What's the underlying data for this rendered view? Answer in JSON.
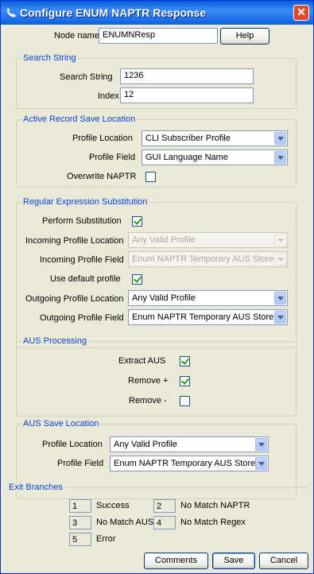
{
  "window": {
    "title": "Configure ENUM NAPTR Response",
    "close_glyph": "✕"
  },
  "node": {
    "label": "Node name",
    "value": "ENUMNResp",
    "help_label": "Help"
  },
  "search_string": {
    "title": "Search String",
    "search_label": "Search String",
    "search_value": "1236",
    "index_label": "Index",
    "index_value": "12"
  },
  "active_record": {
    "title": "Active Record Save Location",
    "profile_location_label": "Profile Location",
    "profile_location_value": "CLI Subscriber Profile",
    "profile_field_label": "Profile Field",
    "profile_field_value": "GUI Language Name",
    "overwrite_label": "Overwrite NAPTR",
    "overwrite_checked": false
  },
  "regex": {
    "title": "Regular Expression Substitution",
    "perform_label": "Perform Substitution",
    "perform_checked": true,
    "incoming_location_label": "Incoming Profile Location",
    "incoming_location_value": "Any Valid Profile",
    "incoming_field_label": "Incoming Profile Field",
    "incoming_field_value": "Enum NAPTR Temporary AUS Store",
    "use_default_label": "Use default profile",
    "use_default_checked": true,
    "outgoing_location_label": "Outgoing Profile Location",
    "outgoing_location_value": "Any Valid Profile",
    "outgoing_field_label": "Outgoing Profile Field",
    "outgoing_field_value": "Enum NAPTR Temporary AUS Store"
  },
  "aus_processing": {
    "title": "AUS Processing",
    "extract_label": "Extract AUS",
    "extract_checked": true,
    "remove_plus_label": "Remove +",
    "remove_plus_checked": true,
    "remove_minus_label": "Remove -",
    "remove_minus_checked": false
  },
  "aus_save": {
    "title": "AUS Save Location",
    "profile_location_label": "Profile Location",
    "profile_location_value": "Any Valid Profile",
    "profile_field_label": "Profile Field",
    "profile_field_value": "Enum NAPTR Temporary AUS Store"
  },
  "exit_branches": {
    "title": "Exit Branches",
    "items": [
      {
        "num": "1",
        "label": "Success"
      },
      {
        "num": "2",
        "label": "No Match NAPTR"
      },
      {
        "num": "3",
        "label": "No Match AUS"
      },
      {
        "num": "4",
        "label": "No Match Regex"
      },
      {
        "num": "5",
        "label": "Error"
      }
    ]
  },
  "footer": {
    "comments_label": "Comments",
    "save_label": "Save",
    "cancel_label": "Cancel"
  },
  "colors": {
    "title_bar": "#0a5bd8",
    "group_title": "#0046d5",
    "check": "#21a121",
    "close": "#e04a2a"
  },
  "icons": {
    "title": "phone-icon",
    "close": "close-icon",
    "dropdown": "chevron-down-icon",
    "check": "check-icon"
  }
}
